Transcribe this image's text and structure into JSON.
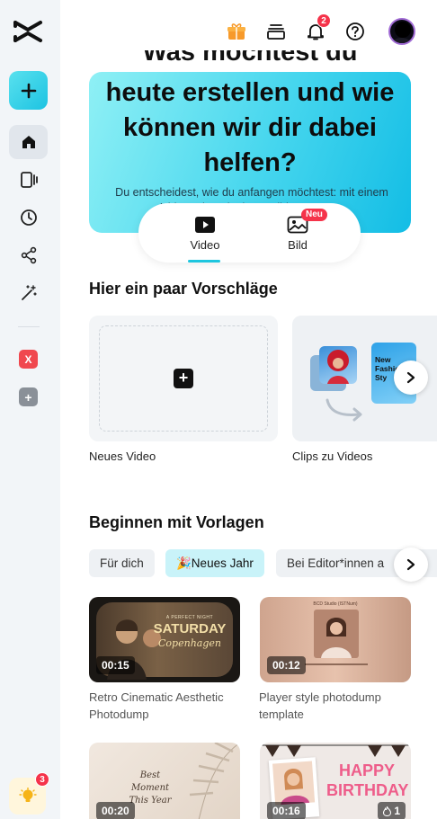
{
  "sidebar": {
    "space_initial": "X",
    "add_space_symbol": "+",
    "tips_count": "3"
  },
  "topbar": {
    "notifications_count": "2"
  },
  "hero": {
    "title_cut": "Was möchtest du",
    "title": "heute erstellen und wie können wir dir dabei helfen?",
    "subtitle": "Du entscheidest, wie du anfangen möchtest: mit einem Video oder mit einem Bild, um etwas",
    "tabs": [
      {
        "label": "Video"
      },
      {
        "label": "Bild",
        "badge": "Neu"
      }
    ]
  },
  "suggestions": {
    "title": "Hier ein paar Vorschläge",
    "cards": [
      {
        "label": "Neues Video"
      },
      {
        "label": "Clips zu Videos",
        "thumb_text": "New Fashion Sty"
      }
    ]
  },
  "templates": {
    "title": "Beginnen mit Vorlagen",
    "chips": [
      {
        "label": "Für dich"
      },
      {
        "label": "🎉Neues Jahr"
      },
      {
        "label": "Bei Editor*innen a"
      }
    ],
    "items": [
      {
        "duration": "00:15",
        "label": "Retro Cinematic Aesthetic Photodump",
        "overlay_top": "A PERFECT NIGHT",
        "overlay_main": "SATURDAY",
        "overlay_sub": "Copenhagen"
      },
      {
        "duration": "00:12",
        "label": "Player style photodump template",
        "overlay_top": "BCD Studio (ISTNum)"
      },
      {
        "duration": "00:20",
        "overlay_main": "Best Moment This Year"
      },
      {
        "duration": "00:16",
        "overlay_main": "HAPPY BIRTHDAY",
        "likes": "1"
      }
    ]
  },
  "colors": {
    "accent": "#1ec6df",
    "badge": "#f5334a",
    "space_badge": "#f0484f"
  }
}
